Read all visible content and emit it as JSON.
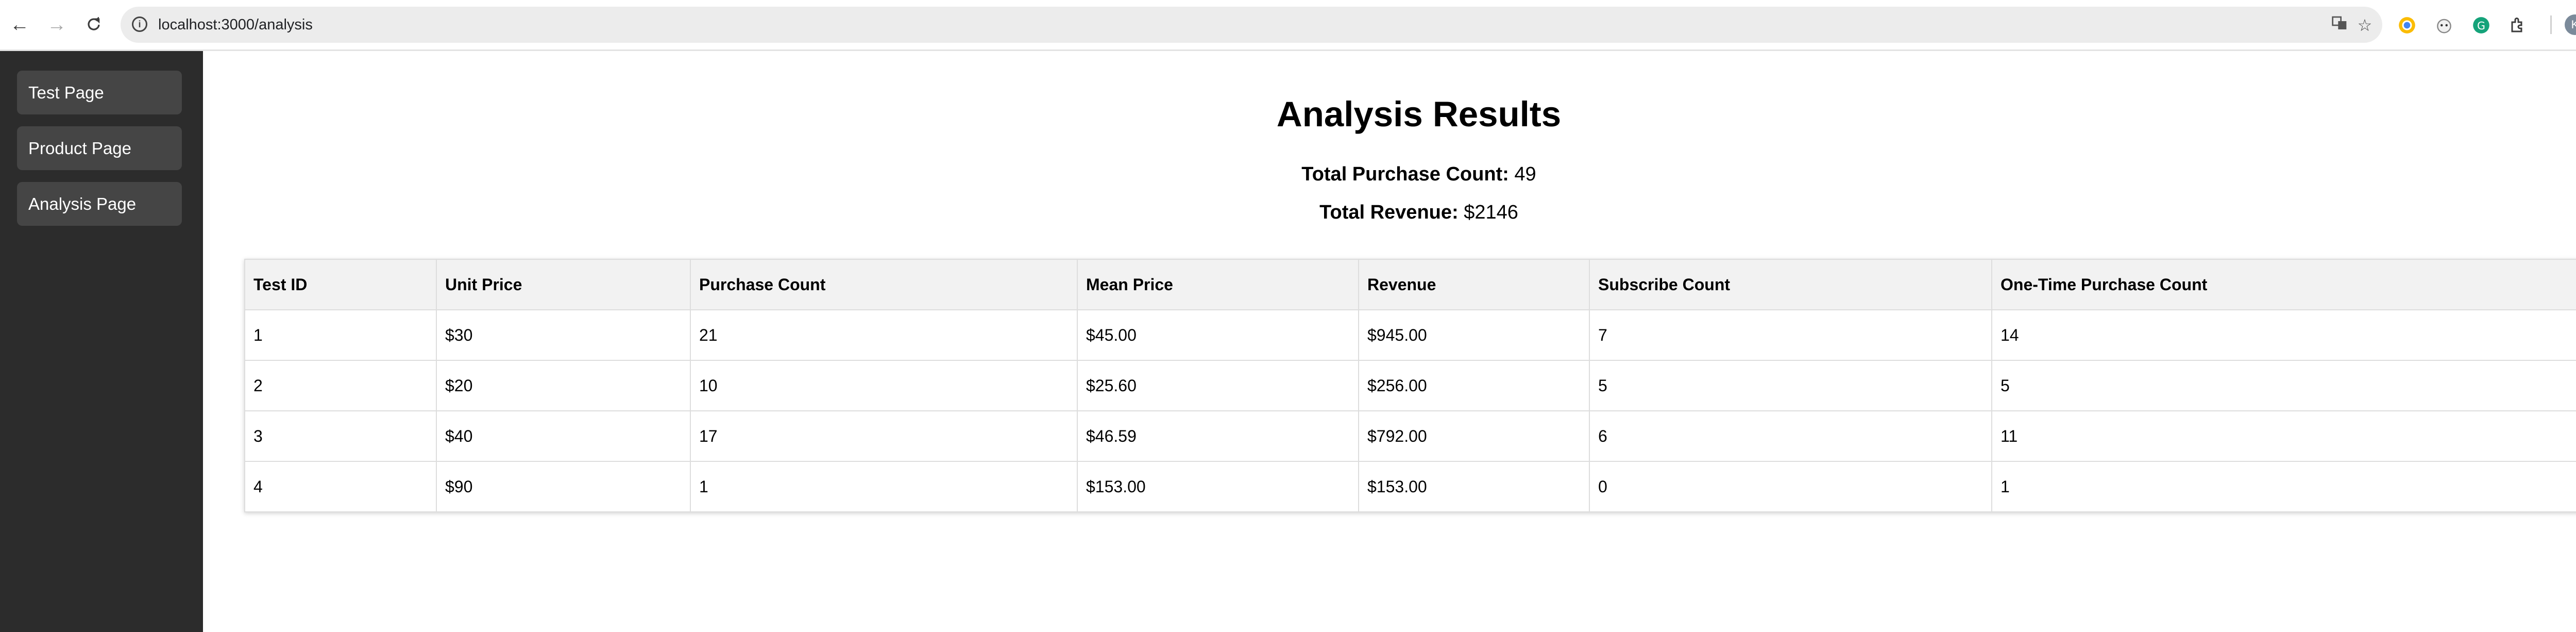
{
  "browser": {
    "url": "localhost:3000/analysis",
    "profile_initial": "K"
  },
  "sidebar": {
    "items": [
      {
        "label": "Test Page"
      },
      {
        "label": "Product Page"
      },
      {
        "label": "Analysis Page"
      }
    ]
  },
  "main": {
    "title": "Analysis Results",
    "total_purchase_label": "Total Purchase Count:",
    "total_purchase_value": "49",
    "total_revenue_label": "Total Revenue:",
    "total_revenue_value": "$2146"
  },
  "table": {
    "headers": [
      "Test ID",
      "Unit Price",
      "Purchase Count",
      "Mean Price",
      "Revenue",
      "Subscribe Count",
      "One-Time Purchase Count"
    ],
    "rows": [
      [
        "1",
        "$30",
        "21",
        "$45.00",
        "$945.00",
        "7",
        "14"
      ],
      [
        "2",
        "$20",
        "10",
        "$25.60",
        "$256.00",
        "5",
        "5"
      ],
      [
        "3",
        "$40",
        "17",
        "$46.59",
        "$792.00",
        "6",
        "11"
      ],
      [
        "4",
        "$90",
        "1",
        "$153.00",
        "$153.00",
        "0",
        "1"
      ]
    ]
  }
}
